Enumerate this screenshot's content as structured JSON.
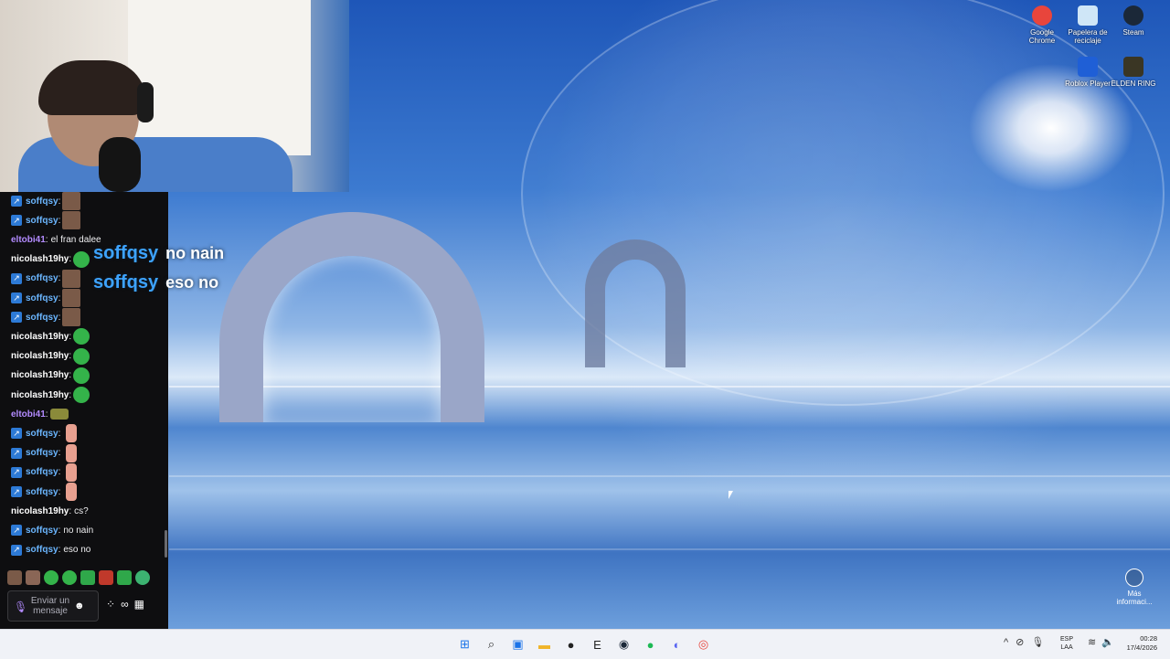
{
  "desktop": {
    "icons": [
      {
        "label": "Google Chrome",
        "color": "#e8453c"
      },
      {
        "label": "Papelera de reciclaje",
        "color": "#cfe6f7"
      },
      {
        "label": "Steam",
        "color": "#1b2838"
      },
      {
        "label": "Roblox Player",
        "color": "#1f5fd6"
      },
      {
        "label": "ELDEN RING",
        "color": "#3a3624"
      }
    ],
    "more_info": "Más informaci..."
  },
  "overlay_chat": [
    {
      "user": "soffqsy",
      "text": "no nain"
    },
    {
      "user": "soffqsy",
      "text": "eso no"
    }
  ],
  "chat": {
    "messages": [
      {
        "user": "soffqsy",
        "text": "",
        "emote": "face",
        "badge": true,
        "color": "b"
      },
      {
        "user": "soffqsy",
        "text": "",
        "emote": "face",
        "badge": true,
        "color": "b"
      },
      {
        "user": "eltobi41",
        "text": "el fran dalee",
        "emote": "",
        "badge": false,
        "color": "p"
      },
      {
        "user": "nicolash19hy",
        "text": "",
        "emote": "green",
        "badge": false,
        "color": "g"
      },
      {
        "user": "soffqsy",
        "text": "",
        "emote": "face",
        "badge": true,
        "color": "b"
      },
      {
        "user": "soffqsy",
        "text": "",
        "emote": "face",
        "badge": true,
        "color": "b"
      },
      {
        "user": "soffqsy",
        "text": "",
        "emote": "face",
        "badge": true,
        "color": "b"
      },
      {
        "user": "nicolash19hy",
        "text": "",
        "emote": "green",
        "badge": false,
        "color": "g"
      },
      {
        "user": "nicolash19hy",
        "text": "",
        "emote": "green",
        "badge": false,
        "color": "g"
      },
      {
        "user": "nicolash19hy",
        "text": "",
        "emote": "green",
        "badge": false,
        "color": "g"
      },
      {
        "user": "nicolash19hy",
        "text": "",
        "emote": "green",
        "badge": false,
        "color": "g"
      },
      {
        "user": "eltobi41",
        "text": "",
        "emote": "hat",
        "badge": false,
        "color": "p"
      },
      {
        "user": "soffqsy",
        "text": "",
        "emote": "hand",
        "badge": true,
        "color": "b"
      },
      {
        "user": "soffqsy",
        "text": "",
        "emote": "hand",
        "badge": true,
        "color": "b"
      },
      {
        "user": "soffqsy",
        "text": "",
        "emote": "hand",
        "badge": true,
        "color": "b"
      },
      {
        "user": "soffqsy",
        "text": "",
        "emote": "hand",
        "badge": true,
        "color": "b"
      },
      {
        "user": "nicolash19hy",
        "text": "cs?",
        "emote": "",
        "badge": false,
        "color": "g"
      },
      {
        "user": "soffqsy",
        "text": "no nain",
        "emote": "",
        "badge": true,
        "color": "b"
      },
      {
        "user": "soffqsy",
        "text": "eso no",
        "emote": "",
        "badge": true,
        "color": "b"
      }
    ],
    "input_placeholder": "Enviar un mensaje",
    "accent": "#b38bff"
  },
  "taskbar": {
    "apps": [
      {
        "name": "start-icon",
        "glyph": "⊞",
        "color": "#1a73e8"
      },
      {
        "name": "search-icon",
        "glyph": "⌕",
        "color": "#333333"
      },
      {
        "name": "store-icon",
        "glyph": "▣",
        "color": "#1a73e8"
      },
      {
        "name": "file-explorer-icon",
        "glyph": "▬",
        "color": "#f0b429"
      },
      {
        "name": "obs-icon",
        "glyph": "●",
        "color": "#222222"
      },
      {
        "name": "epic-games-icon",
        "glyph": "E",
        "color": "#222222"
      },
      {
        "name": "steam-icon",
        "glyph": "◉",
        "color": "#1b2838"
      },
      {
        "name": "spotify-icon",
        "glyph": "●",
        "color": "#1db954"
      },
      {
        "name": "discord-icon",
        "glyph": "◐",
        "color": "#5865f2"
      },
      {
        "name": "chrome-icon",
        "glyph": "◎",
        "color": "#e8453c"
      }
    ],
    "lang_top": "ESP",
    "lang_bottom": "LAA",
    "time": "00:28",
    "date": "17/4/2026"
  }
}
